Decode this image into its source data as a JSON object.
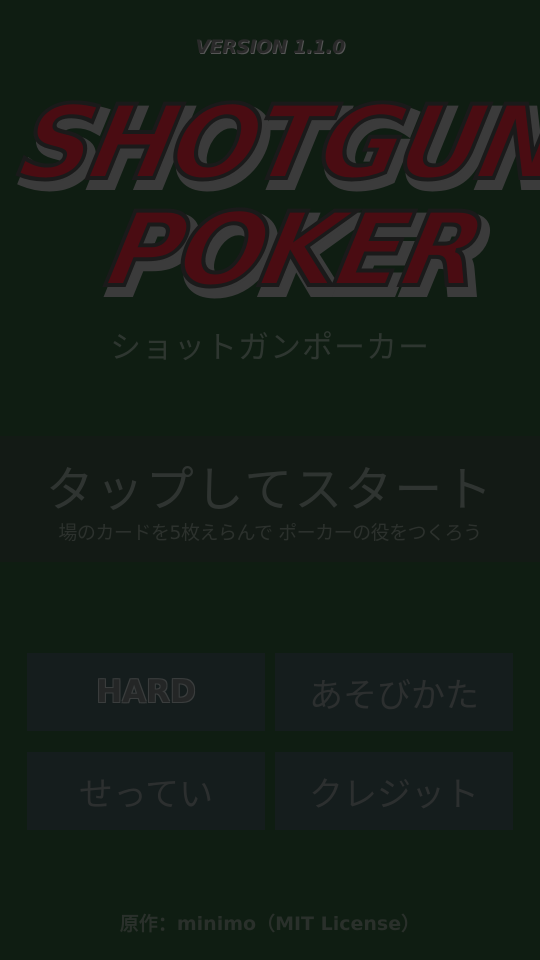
{
  "version": "VERSION 1.1.0",
  "logo": {
    "line1": "SHOTGUN",
    "line2": "POKER",
    "colors": {
      "fill": "#4a0c12",
      "outline": "#1a1a1a",
      "shadow": "#3b3b3b"
    }
  },
  "subtitle": "ショットガンポーカー",
  "start": {
    "title": "タップしてスタート",
    "hint": "場のカードを5枚えらんで ポーカーの役をつくろう"
  },
  "menu": {
    "difficulty": "HARD",
    "how_to_play": "あそびかた",
    "settings": "せってい",
    "credits": "クレジット"
  },
  "footer": {
    "credit": "原作：minimo（MIT License）"
  }
}
